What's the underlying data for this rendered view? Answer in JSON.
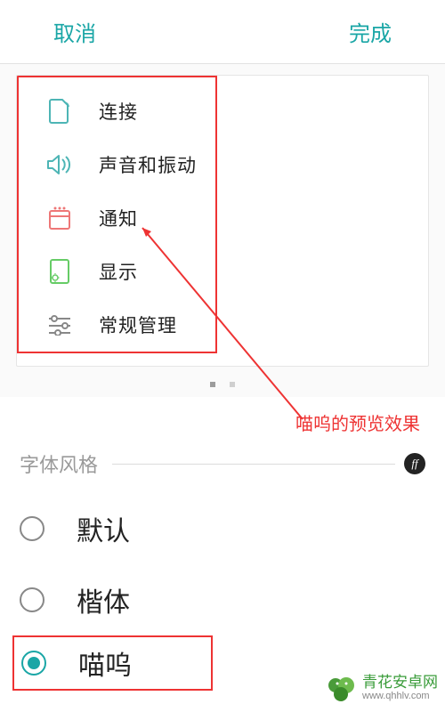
{
  "header": {
    "cancel": "取消",
    "done": "完成"
  },
  "preview": {
    "items": [
      {
        "icon": "sim-icon",
        "label": "连接"
      },
      {
        "icon": "speaker-icon",
        "label": "声音和振动"
      },
      {
        "icon": "notification-icon",
        "label": "通知"
      },
      {
        "icon": "display-icon",
        "label": "显示"
      },
      {
        "icon": "sliders-icon",
        "label": "常规管理"
      }
    ]
  },
  "annotation": "喵呜的预览效果",
  "section": {
    "title": "字体风格",
    "badge": "ff"
  },
  "fonts": [
    {
      "label": "默认",
      "selected": false,
      "class": "default"
    },
    {
      "label": "楷体",
      "selected": false,
      "class": ""
    },
    {
      "label": "喵呜",
      "selected": true,
      "class": ""
    }
  ],
  "watermark": {
    "brand": "青花安卓网",
    "url": "www.qhhlv.com"
  }
}
